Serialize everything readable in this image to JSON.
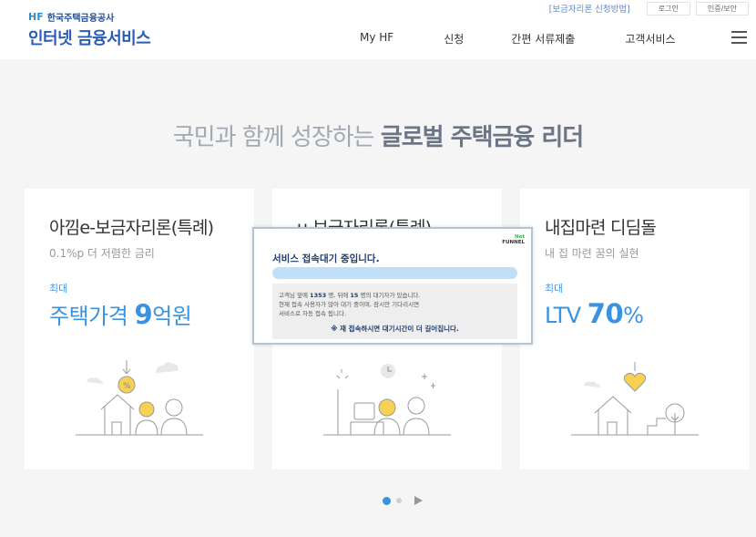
{
  "header": {
    "org_name": "한국주택금융공사",
    "logo_mark": "HF",
    "service_name": "인터넷 금융서비스",
    "util_link": "[보금자리론 신청방법]",
    "login": "로그인",
    "cert": "인증/보안",
    "nav": [
      "My HF",
      "신청",
      "간편 서류제출",
      "고객서비스"
    ]
  },
  "hero": {
    "light": "국민과 함께 성장하는 ",
    "bold": "글로벌 주택금융 리더"
  },
  "cards": [
    {
      "title": "아낌e-보금자리론(특례)",
      "sub": "0.1%p 더 저렴한 금리",
      "small": "최대",
      "big_prefix": "주택가격 ",
      "big_num": "9",
      "big_suffix": "억원"
    },
    {
      "title": "u-보금자리론(특례)"
    },
    {
      "title": "내집마련 디딤돌",
      "sub": "내 집 마련 꿈의 실현",
      "small": "최대",
      "big_prefix": "LTV ",
      "big_num": "70",
      "big_suffix": "%"
    }
  ],
  "popup": {
    "logo_top": "Net",
    "logo_bottom": "FUNNEL",
    "title": "서비스 접속대기 중입니다.",
    "line1_a": "고객님 앞에 ",
    "line1_count": "1353",
    "line1_b": " 명, 뒤에 ",
    "line1_count2": "15",
    "line1_c": " 명의 대기자가 있습니다.",
    "line2": "현재 접속 사용자가 많아 대기 중이며, 잠시만 기다리시면",
    "line3": "서비스로 자동 접속 됩니다.",
    "warning": "※ 재 접속하시면 대기시간이 더 길어집니다."
  },
  "colors": {
    "accent": "#3a93e0",
    "brand": "#2a5bb5"
  }
}
